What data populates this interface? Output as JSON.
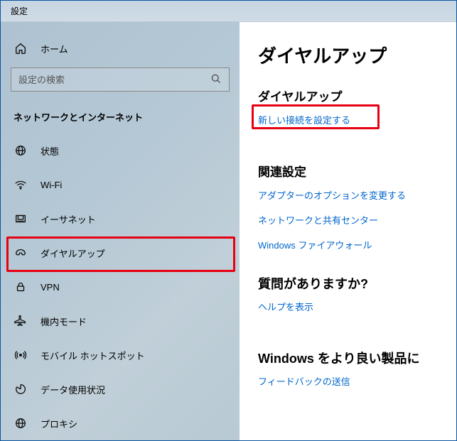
{
  "titlebar": {
    "title": "設定"
  },
  "sidebar": {
    "home": "ホーム",
    "search_placeholder": "設定の検索",
    "category": "ネットワークとインターネット",
    "items": [
      {
        "label": "状態",
        "icon": "status-icon"
      },
      {
        "label": "Wi-Fi",
        "icon": "wifi-icon"
      },
      {
        "label": "イーサネット",
        "icon": "ethernet-icon"
      },
      {
        "label": "ダイヤルアップ",
        "icon": "dialup-icon"
      },
      {
        "label": "VPN",
        "icon": "vpn-icon"
      },
      {
        "label": "機内モード",
        "icon": "airplane-icon"
      },
      {
        "label": "モバイル ホットスポット",
        "icon": "hotspot-icon"
      },
      {
        "label": "データ使用状況",
        "icon": "datausage-icon"
      },
      {
        "label": "プロキシ",
        "icon": "proxy-icon"
      }
    ]
  },
  "content": {
    "page_title": "ダイヤルアップ",
    "section_dialup": "ダイヤルアップ",
    "link_new_connection": "新しい接続を設定する",
    "section_related": "関連設定",
    "link_adapter": "アダプターのオプションを変更する",
    "link_sharingcenter": "ネットワークと共有センター",
    "link_firewall": "Windows ファイアウォール",
    "section_help": "質問がありますか?",
    "link_help": "ヘルプを表示",
    "section_feedback": "Windows をより良い製品に",
    "link_feedback": "フィードバックの送信"
  }
}
